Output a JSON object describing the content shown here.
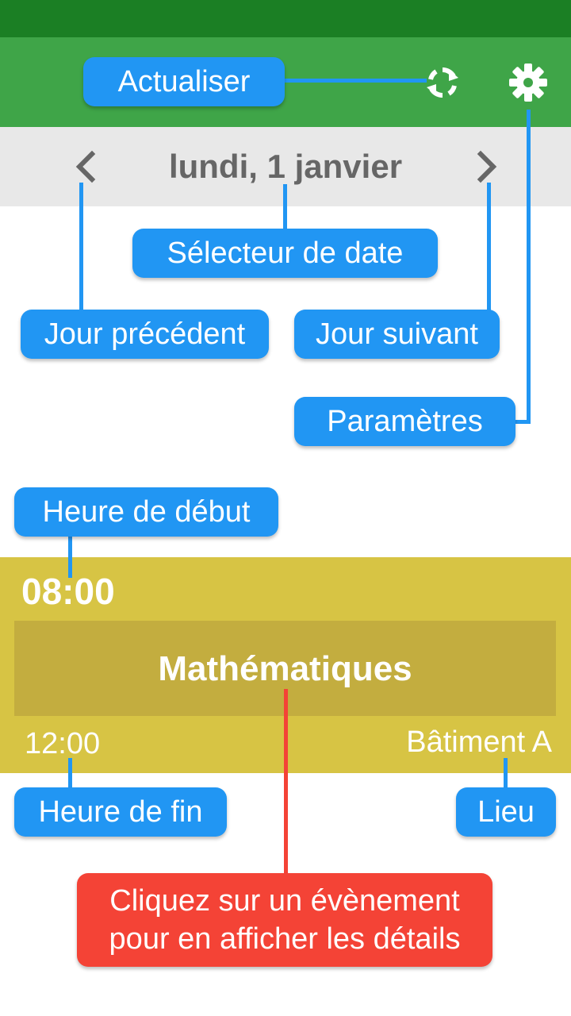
{
  "header": {
    "date_label": "lundi, 1 janvier",
    "refresh_icon": "refresh-icon",
    "settings_icon": "gear-icon",
    "prev_icon": "chevron-left-icon",
    "next_icon": "chevron-right-icon"
  },
  "event": {
    "start_time": "08:00",
    "title": "Mathématiques",
    "end_time": "12:00",
    "location": "Bâtiment A",
    "color": "#d7c444"
  },
  "callouts": {
    "refresh": "Actualiser",
    "date_picker": "Sélecteur de date",
    "previous_day": "Jour précédent",
    "next_day": "Jour suivant",
    "settings": "Paramètres",
    "start_time": "Heure de début",
    "end_time": "Heure de fin",
    "location": "Lieu",
    "details_line1": "Cliquez sur un évènement",
    "details_line2": "pour en afficher les détails"
  },
  "colors": {
    "status_bar": "#1b7f24",
    "toolbar": "#3fa548",
    "callout_blue": "#2196f3",
    "callout_red": "#f44336"
  }
}
